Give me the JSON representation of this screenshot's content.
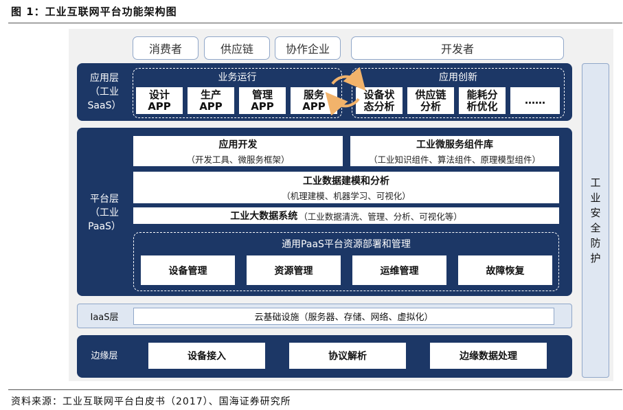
{
  "figure": {
    "title": "图 1：工业互联网平台功能架构图",
    "source": "资料来源：工业互联网平台白皮书（2017）、国海证券研究所"
  },
  "top_roles": [
    "消费者",
    "供应链",
    "协作企业",
    "开发者"
  ],
  "saas": {
    "label_line1": "应用层",
    "label_line2": "（工业SaaS）",
    "business_group": {
      "title": "业务运行",
      "apps": [
        {
          "line1": "设计",
          "line2": "APP"
        },
        {
          "line1": "生产",
          "line2": "APP"
        },
        {
          "line1": "管理",
          "line2": "APP"
        },
        {
          "line1": "服务",
          "line2": "APP"
        }
      ]
    },
    "innovation_group": {
      "title": "应用创新",
      "apps": [
        {
          "line1": "设备状",
          "line2": "态分析"
        },
        {
          "line1": "供应链",
          "line2": "分析"
        },
        {
          "line1": "能耗分",
          "line2": "析优化"
        },
        {
          "line1": "……",
          "line2": ""
        }
      ]
    }
  },
  "paas": {
    "label_line1": "平台层",
    "label_line2": "（工业PaaS）",
    "app_dev": {
      "title": "应用开发",
      "sub": "（开发工具、微服务框架）"
    },
    "microservice": {
      "title": "工业微服务组件库",
      "sub": "（工业知识组件、算法组件、原理模型组件）"
    },
    "modeling": {
      "title": "工业数据建模和分析",
      "sub": "（机理建模、机器学习、可视化）"
    },
    "bigdata": {
      "title": "工业大数据系统",
      "sub": "（工业数据清洗、管理、分析、可视化等）"
    },
    "resource": {
      "title": "通用PaaS平台资源部署和管理",
      "items": [
        "设备管理",
        "资源管理",
        "运维管理",
        "故障恢复"
      ]
    }
  },
  "iaas": {
    "label": "IaaS层",
    "content": "云基础设施（服务器、存储、网络、虚拟化）"
  },
  "edge": {
    "label": "边缘层",
    "items": [
      "设备接入",
      "协议解析",
      "边缘数据处理"
    ]
  },
  "security": {
    "label": "工业安全防护"
  },
  "colors": {
    "navy": "#1c3766",
    "light_blue": "#dfe7f2",
    "border_blue": "#8fa6c8",
    "arrow_orange": "#f2b36b"
  }
}
